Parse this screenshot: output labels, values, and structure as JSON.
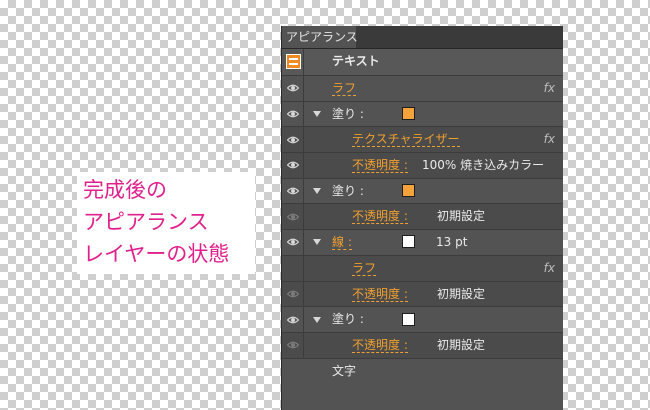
{
  "caption": {
    "lines": [
      "完成後の",
      "アピアランス",
      "レイヤーの状態"
    ],
    "color": "#e0208c"
  },
  "panel": {
    "tab": "アピアランス",
    "object_title": "テキスト",
    "fx_symbol": "fx",
    "rows": [
      {
        "label": "ラフ"
      },
      {
        "label": "塗り :",
        "swatch": "#f4a23a"
      },
      {
        "label": "テクスチャライザー"
      },
      {
        "label": "不透明度 :",
        "value": "100% 焼き込みカラー"
      },
      {
        "label": "塗り :",
        "swatch": "#f4a23a"
      },
      {
        "label": "不透明度 :",
        "value": "初期設定"
      },
      {
        "label": "線 :",
        "swatch": "#ffffff",
        "value": "13 pt"
      },
      {
        "label": "ラフ"
      },
      {
        "label": "不透明度 :",
        "value": "初期設定"
      },
      {
        "label": "塗り :",
        "swatch": "#ffffff"
      },
      {
        "label": "不透明度 :",
        "value": "初期設定"
      }
    ],
    "footer": "文字",
    "accent": "#f0a030"
  }
}
